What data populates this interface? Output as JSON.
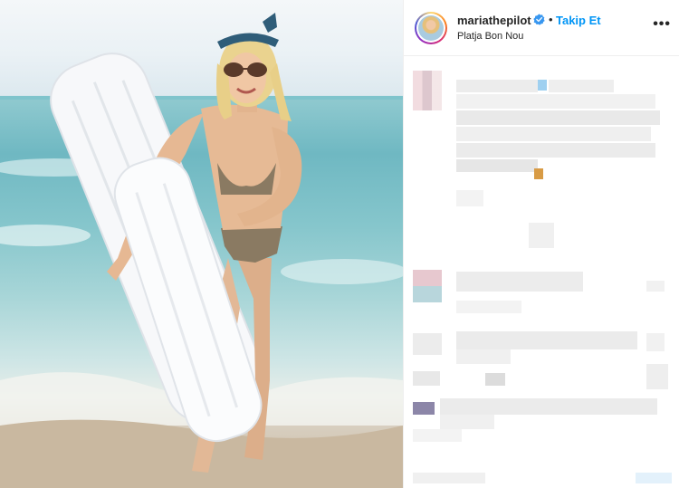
{
  "post": {
    "username": "mariathepilot",
    "follow_label": "Takip Et",
    "separator": "•",
    "location": "Platja Bon Nou",
    "more_label": "•••"
  },
  "icons": {
    "verified": "verified-badge-icon",
    "more": "more-options-icon"
  },
  "colors": {
    "accent": "#0095f6",
    "text": "#262626",
    "verified": "#3897f0"
  }
}
